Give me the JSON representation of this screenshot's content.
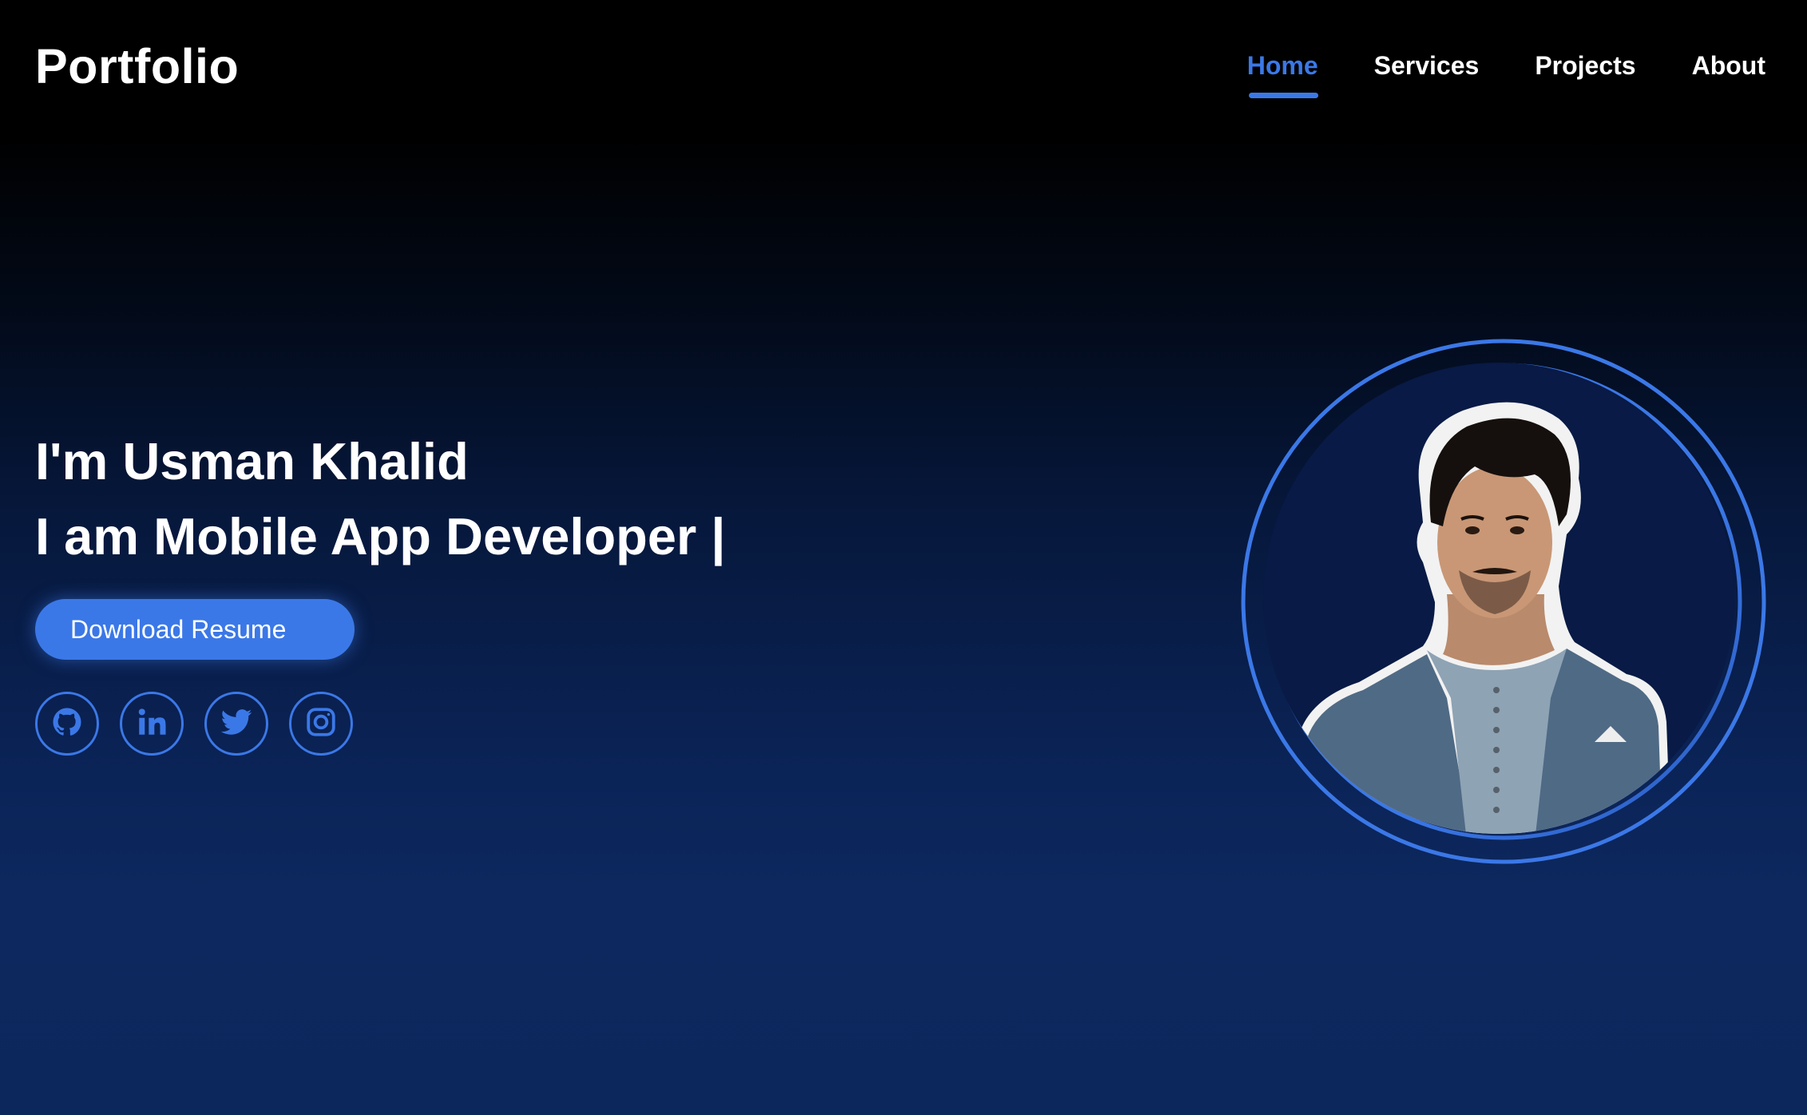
{
  "header": {
    "logo": "Portfolio",
    "nav": [
      {
        "label": "Home",
        "active": true
      },
      {
        "label": "Services",
        "active": false
      },
      {
        "label": "Projects",
        "active": false
      },
      {
        "label": "About",
        "active": false
      }
    ]
  },
  "hero": {
    "name_line": "I'm Usman Khalid",
    "role_line": "I am Mobile App Developer |",
    "download_button": "Download Resume"
  },
  "socials": [
    {
      "icon": "github-icon"
    },
    {
      "icon": "linkedin-icon"
    },
    {
      "icon": "twitter-icon"
    },
    {
      "icon": "instagram-icon"
    }
  ],
  "colors": {
    "accent": "#3b78e7",
    "background_top": "#000000",
    "background_bottom": "#0c275c",
    "text": "#ffffff"
  }
}
